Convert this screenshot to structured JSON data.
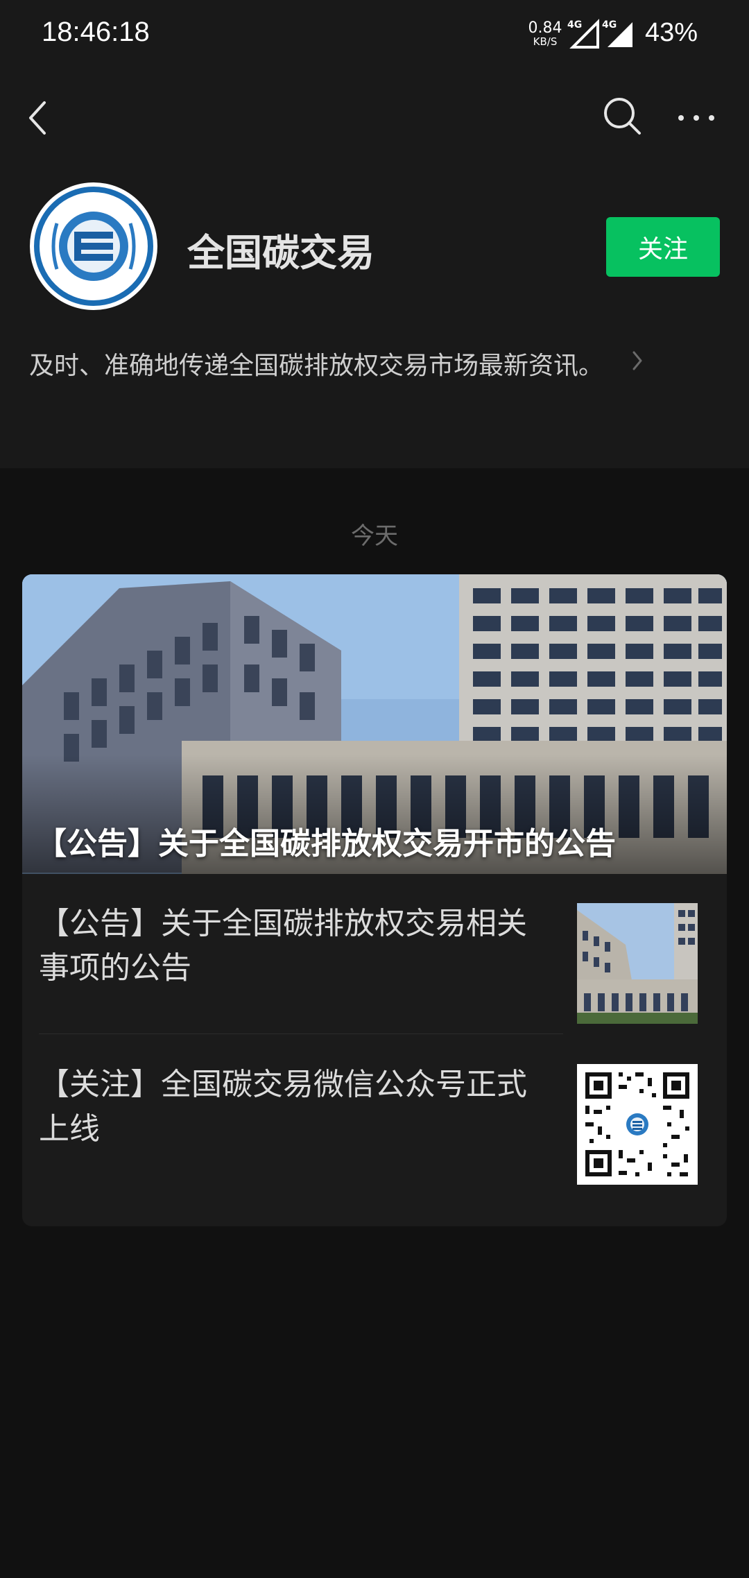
{
  "status_bar": {
    "time": "18:46:18",
    "net_speed_value": "0.84",
    "net_speed_unit": "KB/S",
    "network_1": "4G",
    "network_2": "4G",
    "battery": "43%"
  },
  "nav": {
    "back_icon": "chevron-left-icon",
    "search_icon": "search-icon",
    "more_icon": "more-horizontal-icon"
  },
  "account": {
    "name": "全国碳交易",
    "follow_label": "关注",
    "description": "及时、准确地传递全国碳排放权交易市场最新资讯。",
    "follow_color": "#07c160"
  },
  "feed": {
    "date_label": "今天",
    "cover_title": "【公告】关于全国碳排放权交易开市的公告",
    "items": [
      {
        "title": "【公告】关于全国碳排放权交易相关事项的公告",
        "thumb": "building-photo"
      },
      {
        "title": "【关注】全国碳交易微信公众号正式上线",
        "thumb": "qr-code"
      }
    ]
  }
}
